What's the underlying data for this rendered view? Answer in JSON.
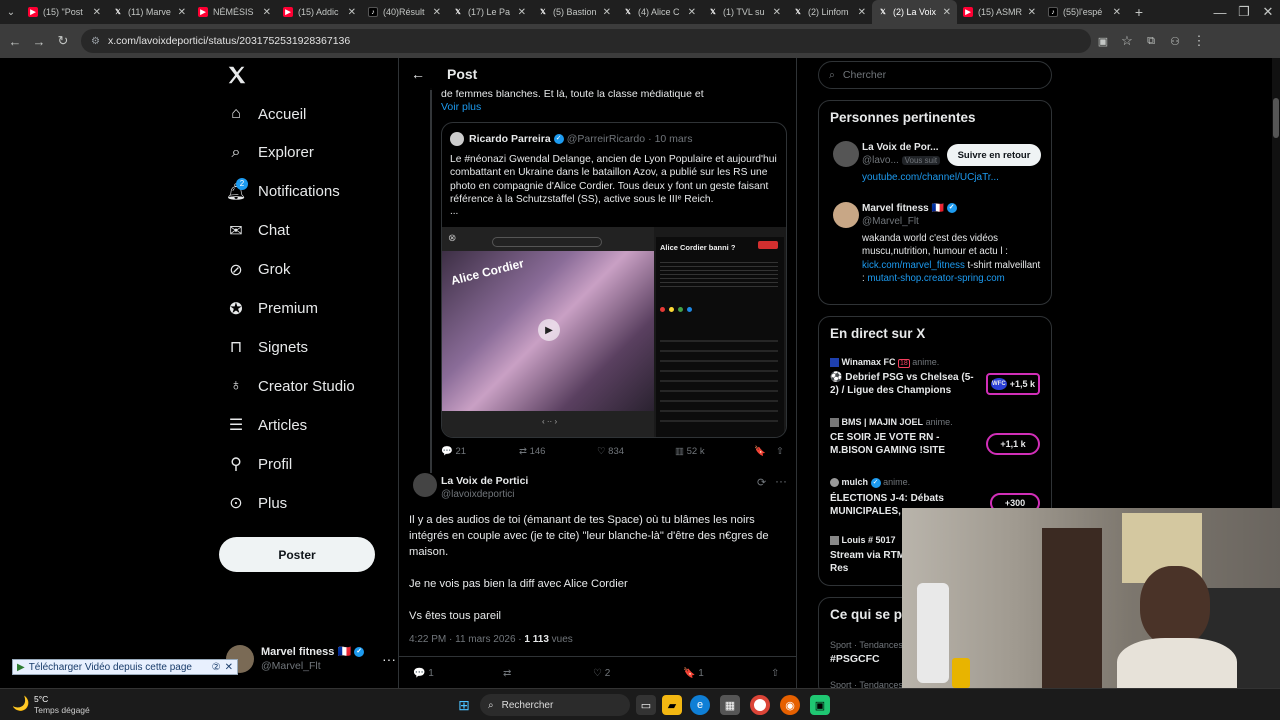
{
  "browser": {
    "tabs": [
      {
        "icon": "youtube-icon",
        "color": "#ff0033",
        "title": "(15) \"Post"
      },
      {
        "icon": "x-icon",
        "color": "#ffffff",
        "title": "(11) Marve"
      },
      {
        "icon": "youtube-icon",
        "color": "#ff0033",
        "title": "NÉMÉSIS"
      },
      {
        "icon": "youtube-icon",
        "color": "#ff0033",
        "title": "(15) Addic"
      },
      {
        "icon": "tiktok-icon",
        "color": "#000000",
        "title": "(40)Résult"
      },
      {
        "icon": "x-icon",
        "color": "#ffffff",
        "title": "(17) Le Pa"
      },
      {
        "icon": "x-icon",
        "color": "#ffffff",
        "title": "(5) Bastion"
      },
      {
        "icon": "x-icon",
        "color": "#ffffff",
        "title": "(4) Alice C"
      },
      {
        "icon": "x-icon",
        "color": "#ffffff",
        "title": "(1) TVL su"
      },
      {
        "icon": "x-icon",
        "color": "#ffffff",
        "title": "(2) Linfom"
      },
      {
        "icon": "x-icon",
        "color": "#ffffff",
        "title": "(2) La Voix",
        "active": true
      },
      {
        "icon": "youtube-icon",
        "color": "#ff0033",
        "title": "(15) ASMR"
      },
      {
        "icon": "tiktok-icon",
        "color": "#000000",
        "title": "(55)l'espé"
      }
    ],
    "url": "x.com/lavoixdeportici/status/2031752531928367136"
  },
  "sidebar": {
    "items": [
      {
        "label": "Accueil",
        "icon": "home-icon"
      },
      {
        "label": "Explorer",
        "icon": "search-icon"
      },
      {
        "label": "Notifications",
        "icon": "bell-icon",
        "badge": "2"
      },
      {
        "label": "Chat",
        "icon": "mail-icon"
      },
      {
        "label": "Grok",
        "icon": "grok-icon"
      },
      {
        "label": "Premium",
        "icon": "premium-icon"
      },
      {
        "label": "Signets",
        "icon": "bookmark-icon"
      },
      {
        "label": "Creator Studio",
        "icon": "creator-icon"
      },
      {
        "label": "Articles",
        "icon": "articles-icon"
      },
      {
        "label": "Profil",
        "icon": "profile-icon"
      },
      {
        "label": "Plus",
        "icon": "more-icon"
      }
    ],
    "post_button": "Poster",
    "account": {
      "name": "Marvel fitness",
      "flag": "🇫🇷",
      "handle": "@Marvel_Flt"
    }
  },
  "header": {
    "title": "Post"
  },
  "parent_tweet": {
    "truncated_line": "de femmes blanches. Et là, toute la classe médiatique et",
    "see_more": "Voir plus",
    "quote": {
      "name": "Ricardo Parreira",
      "handle": "@ParreirRicardo",
      "date": "10 mars",
      "text": "Le #néonazi Gwendal Delange, ancien de Lyon Populaire et aujourd'hui combattant en Ukraine dans le bataillon Azov, a publié sur les RS une photo en compagnie d'Alice Cordier. Tous deux y font un geste faisant référence à la Schutzstaffel (SS), active sous le IIIᵉ Reich.",
      "ellipsis": "...",
      "image_caption": "Alice Cordier",
      "panel_title": "Alice Cordier banni ?"
    },
    "stats": {
      "replies": "21",
      "reposts": "146",
      "likes": "834",
      "views": "52 k"
    }
  },
  "reply_tweet": {
    "name": "La Voix de Portici",
    "handle": "@lavoixdeportici",
    "paragraphs": [
      "Il y a des audios de toi (émanant de tes Space) où tu blâmes les noirs intégrés en couple avec (je te cite) \"leur blanche-là\" d'être des n€gres de maison.",
      "Je ne vois pas bien la diff avec Alice Cordier",
      "Vs êtes tous pareil"
    ],
    "time": "4:22 PM · 11 mars 2026 · ",
    "views_count": "1 113",
    "views_label": " vues",
    "stats": {
      "replies": "1",
      "reposts": "",
      "likes": "2",
      "bookmarks": "1"
    }
  },
  "search": {
    "placeholder": "Chercher"
  },
  "relevant": {
    "title": "Personnes pertinentes",
    "people": [
      {
        "name": "La Voix de Por...",
        "handle": "@lavo...",
        "follows_you": "Vous suit",
        "button": "Suivre en retour",
        "bio_link": "youtube.com/channel/UCjaTr..."
      },
      {
        "name": "Marvel fitness",
        "flag": "🇫🇷",
        "handle": "@Marvel_Flt",
        "bio_start": "wakanda world c'est des vidéos muscu,nutrition, humour et actu l :",
        "bio_link1": "kick.com/marvel_fitness",
        "bio_mid": " t-shirt malveillant : ",
        "bio_link2": "mutant-shop.creator-spring.com"
      }
    ]
  },
  "live": {
    "title": "En direct sur X",
    "items": [
      {
        "host": "Winamax FC",
        "extra": "18",
        "status": "anime.",
        "title": "⚽ Debrief PSG vs Chelsea (5-2) / Ligue des Champions",
        "count": "+1,5 k",
        "badge": "WFC"
      },
      {
        "host": "BMS | MAJIN JOEL",
        "status": "anime.",
        "title": "CE SOIR JE VOTE RN - M.BISON GAMING !SITE",
        "count": "+1,1 k"
      },
      {
        "host": "mulch",
        "status": "anime.",
        "title": "ÉLECTIONS J-4: Débats MUNICIPALES,",
        "count": "+300"
      },
      {
        "host": "Louis # 5017",
        "status": "",
        "title": "Stream via RTM Zoom) with Res"
      }
    ]
  },
  "trending": {
    "title": "Ce qui se p",
    "items": [
      {
        "meta": "Sport · Tendances",
        "tag": "#PSGCFC"
      },
      {
        "meta": "Sport · Tendances",
        "tag": ""
      }
    ]
  },
  "download_bar": {
    "label": "Télécharger Vidéo depuis cette page",
    "close": "✕"
  },
  "taskbar": {
    "temp": "5°C",
    "weather": "Temps dégagé",
    "search": "Rechercher"
  }
}
